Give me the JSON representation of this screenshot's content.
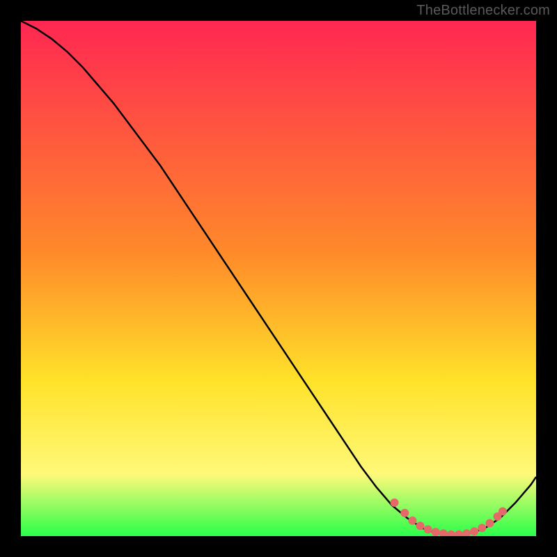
{
  "watermark": "TheBottlenecker.com",
  "colors": {
    "bg": "#000000",
    "line": "#000000",
    "marker": "#e46a6a",
    "grad_top": "#ff2752",
    "grad_mid1": "#ff8a2a",
    "grad_mid2": "#ffe22a",
    "grad_mid3": "#fff97a",
    "grad_bottom": "#2aff4a"
  },
  "chart_data": {
    "type": "line",
    "title": "",
    "xlabel": "",
    "ylabel": "",
    "xlim": [
      0,
      100
    ],
    "ylim": [
      0,
      100
    ],
    "x": [
      0,
      3,
      6,
      9,
      12,
      15,
      18,
      21,
      24,
      27,
      30,
      33,
      36,
      39,
      42,
      45,
      48,
      51,
      54,
      57,
      60,
      63,
      66,
      69,
      72,
      75,
      78,
      81,
      84,
      87,
      90,
      93,
      96,
      99,
      100
    ],
    "y": [
      100,
      98.5,
      96.5,
      94,
      91,
      87.5,
      84,
      80,
      76,
      72,
      67.5,
      63,
      58.5,
      54,
      49.5,
      45,
      40.5,
      36,
      31.5,
      27,
      22.5,
      18,
      13.5,
      9.5,
      6,
      3.5,
      1.5,
      0.5,
      0.2,
      0.5,
      1.5,
      3.5,
      6.5,
      10,
      11.5
    ],
    "markers_x": [
      72.5,
      74.5,
      76,
      77.5,
      79,
      80.5,
      82,
      83.5,
      85,
      86.5,
      88,
      89.5,
      91,
      92.5,
      93.5
    ],
    "markers_y": [
      6.5,
      4.5,
      3,
      2,
      1.3,
      0.8,
      0.5,
      0.3,
      0.3,
      0.5,
      0.9,
      1.6,
      2.5,
      3.8,
      4.8
    ]
  }
}
